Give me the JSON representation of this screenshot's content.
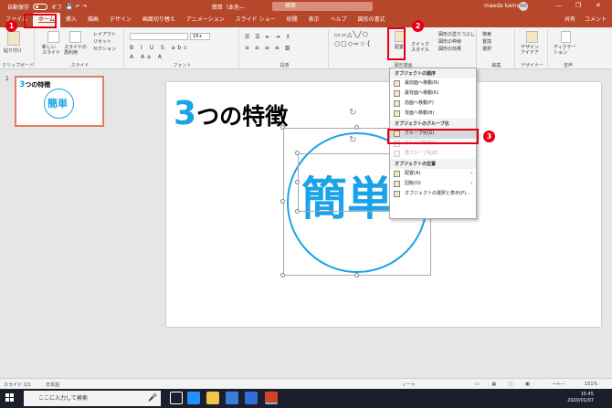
{
  "titlebar": {
    "autosave": "自動保存",
    "autosave_state": "オフ",
    "doc_title": "簡単（本色—",
    "search_placeholder": "検索",
    "user_name": "maeda kamari",
    "avatar_initials": "MK",
    "minimize": "—",
    "restore": "❐",
    "close": "✕"
  },
  "tabs": {
    "items": [
      "ファイル",
      "ホーム",
      "挿入",
      "描画",
      "デザイン",
      "画面切り替え",
      "アニメーション",
      "スライド ショー",
      "校閲",
      "表示",
      "ヘルプ",
      "図形の書式"
    ],
    "share": "共有",
    "comment": "コメント"
  },
  "ribbon": {
    "groups": {
      "clipboard": "クリップボード",
      "slides": "スライド",
      "font": "フォント",
      "paragraph": "段落",
      "drawing": "図形描画",
      "editing": "編集",
      "designer": "デザイナー",
      "voice": "音声"
    },
    "paste": "貼り付け",
    "new_slide": "新しい\nスライド",
    "reuse": "スライドの\n再利用",
    "layout": "レイアウト",
    "reset": "リセット",
    "section": "セクション",
    "font_size": "18+",
    "arrange": "配置",
    "quick_style": "クイック\nスタイル",
    "fill": "図形の塗りつぶし",
    "outline": "図形の枠線",
    "effect": "図形の効果",
    "find": "検索",
    "replace": "置換",
    "select": "選択",
    "design_ideas": "デザイン\nアイデア",
    "dictate": "ディクテー\nション"
  },
  "menu": {
    "head_order": "オブジェクトの順序",
    "order_items": [
      "最前面へ移動(R)",
      "最背面へ移動(K)",
      "前面へ移動(F)",
      "背面へ移動(B)"
    ],
    "head_group": "オブジェクトのグループ化",
    "group_items": [
      {
        "label": "グループ化(G)",
        "disabled": false,
        "highlight": true
      },
      {
        "label": "グループ解除(U)",
        "disabled": true,
        "highlight": false
      },
      {
        "label": "再グループ化(E)",
        "disabled": true,
        "highlight": false
      }
    ],
    "head_position": "オブジェクトの位置",
    "position_items": [
      "配置(A)",
      "回転(O)"
    ],
    "selection_pane": "オブジェクトの選択と表示(P)..."
  },
  "annotations": {
    "b1": "1",
    "b2": "2",
    "b3": "3"
  },
  "thumbnail": {
    "number": "1",
    "title_num": "3",
    "title_rest": "つの特徴",
    "shape_text": "簡単"
  },
  "slide": {
    "title_num": "3",
    "title_rest": "つの特徴",
    "shape_text": "簡単"
  },
  "status": {
    "slide_info": "スライド 1/1",
    "language": "日本語",
    "notes": "ノート",
    "zoom": "101%"
  },
  "taskbar": {
    "search": "ここに入力して検索",
    "time": "15:45",
    "date": "2020/01/07",
    "colors": {
      "edge": "#1e90ff",
      "explorer": "#f2c44b",
      "store": "#3b7ddd",
      "mail": "#2f6fd6",
      "powerpoint": "#d04423"
    }
  },
  "colors": {
    "accent": "#b7472a",
    "shape_blue": "#1aa3e8",
    "annotation_red": "#e60012"
  }
}
